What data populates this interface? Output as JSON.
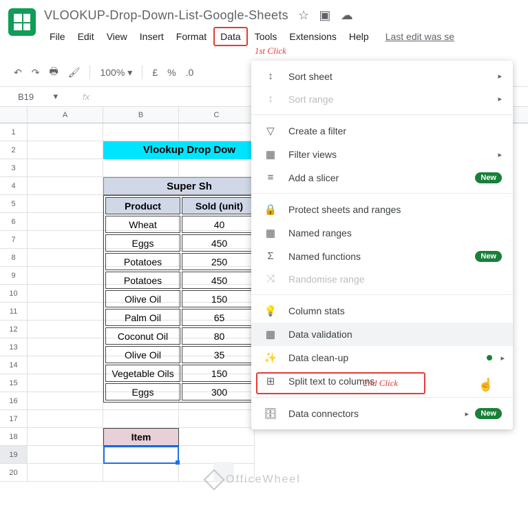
{
  "doc": {
    "title": "VLOOKUP-Drop-Down-List-Google-Sheets"
  },
  "menubar": {
    "file": "File",
    "edit": "Edit",
    "view": "View",
    "insert": "Insert",
    "format": "Format",
    "data": "Data",
    "tools": "Tools",
    "extensions": "Extensions",
    "help": "Help",
    "last_edit": "Last edit was se"
  },
  "annotations": {
    "click1": "1st Click",
    "click2": "2nd Click"
  },
  "toolbar": {
    "zoom": "100%",
    "currency": "£",
    "percent": "%",
    "decimal": ".0"
  },
  "namebox": {
    "cell": "B19",
    "fx": "fx"
  },
  "columns": [
    "A",
    "B",
    "C"
  ],
  "rows": [
    "1",
    "2",
    "3",
    "4",
    "5",
    "6",
    "7",
    "8",
    "9",
    "10",
    "11",
    "12",
    "13",
    "14",
    "15",
    "16",
    "17",
    "18",
    "19",
    "20"
  ],
  "sheet": {
    "banner": "Vlookup Drop Dow",
    "shop_header": "Super Sh",
    "headers": {
      "product": "Product",
      "sold": "Sold (unit)"
    },
    "data": [
      {
        "p": "Wheat",
        "s": "40"
      },
      {
        "p": "Eggs",
        "s": "450"
      },
      {
        "p": "Potatoes",
        "s": "250"
      },
      {
        "p": "Potatoes",
        "s": "450"
      },
      {
        "p": "Olive Oil",
        "s": "150"
      },
      {
        "p": "Palm Oil",
        "s": "65"
      },
      {
        "p": "Coconut Oil",
        "s": "80"
      },
      {
        "p": "Olive Oil",
        "s": "35"
      },
      {
        "p": "Vegetable Oils",
        "s": "150"
      },
      {
        "p": "Eggs",
        "s": "300"
      }
    ],
    "item_label": "Item"
  },
  "dropdown": {
    "sort_sheet": "Sort sheet",
    "sort_range": "Sort range",
    "create_filter": "Create a filter",
    "filter_views": "Filter views",
    "add_slicer": "Add a slicer",
    "protect": "Protect sheets and ranges",
    "named_ranges": "Named ranges",
    "named_functions": "Named functions",
    "randomise": "Randomise range",
    "column_stats": "Column stats",
    "data_validation": "Data validation",
    "data_cleanup": "Data clean-up",
    "split_text": "Split text to columns",
    "data_connectors": "Data connectors",
    "new_badge": "New"
  },
  "watermark": "OfficeWheel"
}
